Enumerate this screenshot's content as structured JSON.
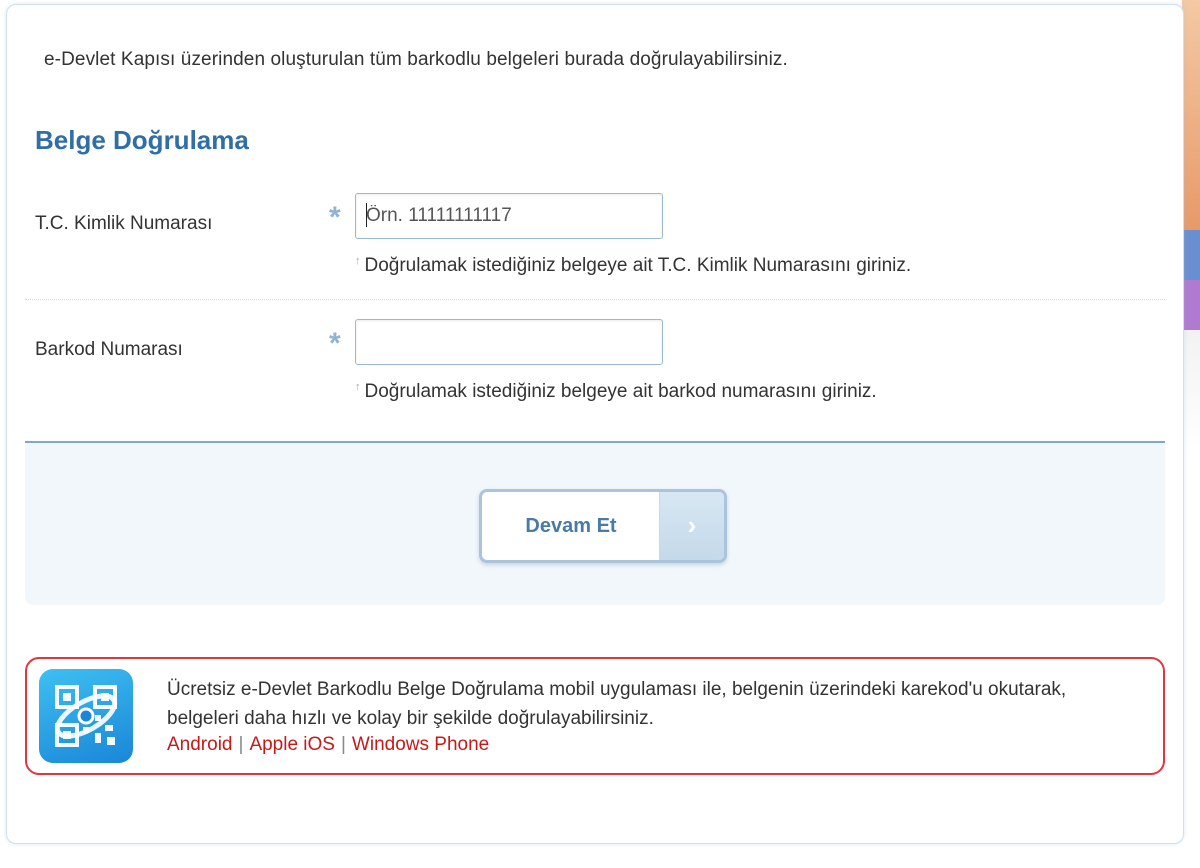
{
  "intro_text": "e-Devlet Kapısı üzerinden oluşturulan tüm barkodlu belgeleri burada doğrulayabilirsiniz.",
  "section_title": "Belge Doğrulama",
  "fields": [
    {
      "label": "T.C. Kimlik Numarası",
      "required_mark": "*",
      "value": "",
      "placeholder": "Örn. 11111111117",
      "hint": "Doğrulamak istediğiniz belgeye ait T.C. Kimlik Numarasını giriniz.",
      "hint_icon": "up-arrow-icon"
    },
    {
      "label": "Barkod Numarası",
      "required_mark": "*",
      "value": "",
      "placeholder": "",
      "hint": "Doğrulamak istediğiniz belgeye ait barkod numarasını giriniz.",
      "hint_icon": "up-arrow-icon"
    }
  ],
  "continue_button": {
    "label": "Devam Et",
    "icon": "chevron-right-icon"
  },
  "promo": {
    "icon": "qr-barcode-app-icon",
    "text": "Ücretsiz e-Devlet Barkodlu Belge Doğrulama mobil uygulaması ile, belgenin üzerindeki karekod'u okutarak, belgeleri daha hızlı ve kolay bir şekilde doğrulayabilirsiniz.",
    "links": [
      "Android",
      "Apple iOS",
      "Windows Phone"
    ],
    "separator": "|"
  },
  "colors": {
    "title_blue": "#2f6ea6",
    "link_red": "#c41a1a",
    "promo_border": "#e0363f",
    "action_bg": "#f2f7fb"
  }
}
